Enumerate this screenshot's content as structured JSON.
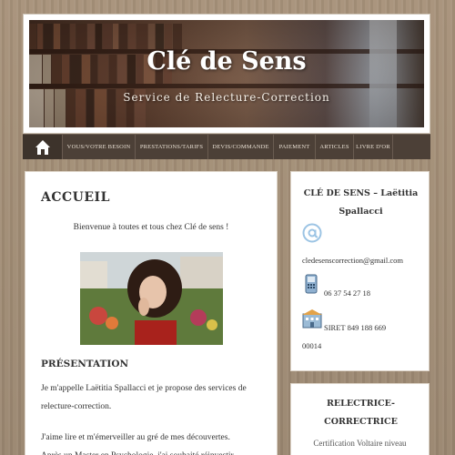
{
  "header": {
    "site_title": "Clé de Sens",
    "tagline": "Service de Relecture-Correction"
  },
  "nav": {
    "home_icon": "home-icon",
    "items": [
      {
        "label": "VOUS/VOTRE BESOIN"
      },
      {
        "label": "PRESTATIONS/TARIFS"
      },
      {
        "label": "DEVIS/COMMANDE"
      },
      {
        "label": "PAIEMENT"
      },
      {
        "label": "ARTICLES"
      },
      {
        "label": "LIVRE D'OR"
      }
    ]
  },
  "main": {
    "page_title": "ACCUEIL",
    "welcome": "Bienvenue à toutes et tous chez Clé de sens !",
    "section_title": "PRÉSENTATION",
    "para1_line1": "Je m'appelle Laëtitia Spallacci et je propose des services de",
    "para1_line2": "relecture-correction.",
    "para2_line1": "J'aime lire et m'émerveiller au gré de mes découvertes.",
    "para2_line2": "Après un Master en Psychologie, j'ai souhaité réinvestir"
  },
  "sidebar": {
    "contact": {
      "title_line1": "CLÉ DE SENS – Laëtitia",
      "title_line2": "Spallacci",
      "email": "cledesenscorrection@gmail.com",
      "phone": "06 37 54 27 18",
      "siret_line1": "SIRET 849 188 669",
      "siret_line2": "00014"
    },
    "profile": {
      "title_line1": "RELECTRICE-",
      "title_line2": "CORRECTRICE",
      "certification": "Certification Voltaire niveau"
    }
  },
  "colors": {
    "nav_bg": "#4c4037",
    "page_bg": "#a08c74",
    "email_icon": "#9cc4e4"
  }
}
